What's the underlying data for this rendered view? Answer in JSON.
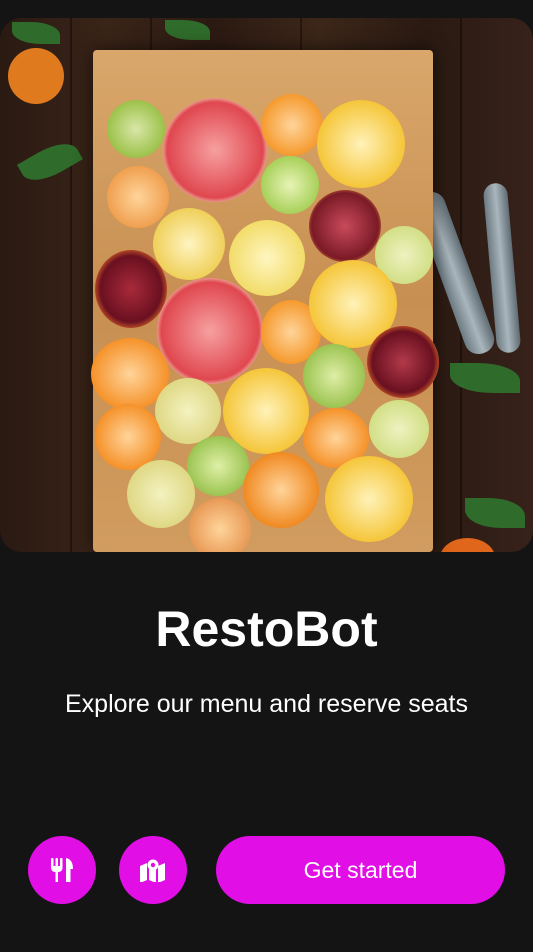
{
  "app": {
    "title": "RestoBot",
    "subtitle": "Explore our menu and reserve seats"
  },
  "hero": {
    "image_alt": "Halved citrus fruits on a wooden cutting board"
  },
  "actions": {
    "menu_icon": "fork-knife-icon",
    "map_icon": "map-icon",
    "cta_label": "Get started"
  },
  "colors": {
    "accent": "#e10fe6",
    "background": "#141414",
    "text": "#ffffff"
  }
}
